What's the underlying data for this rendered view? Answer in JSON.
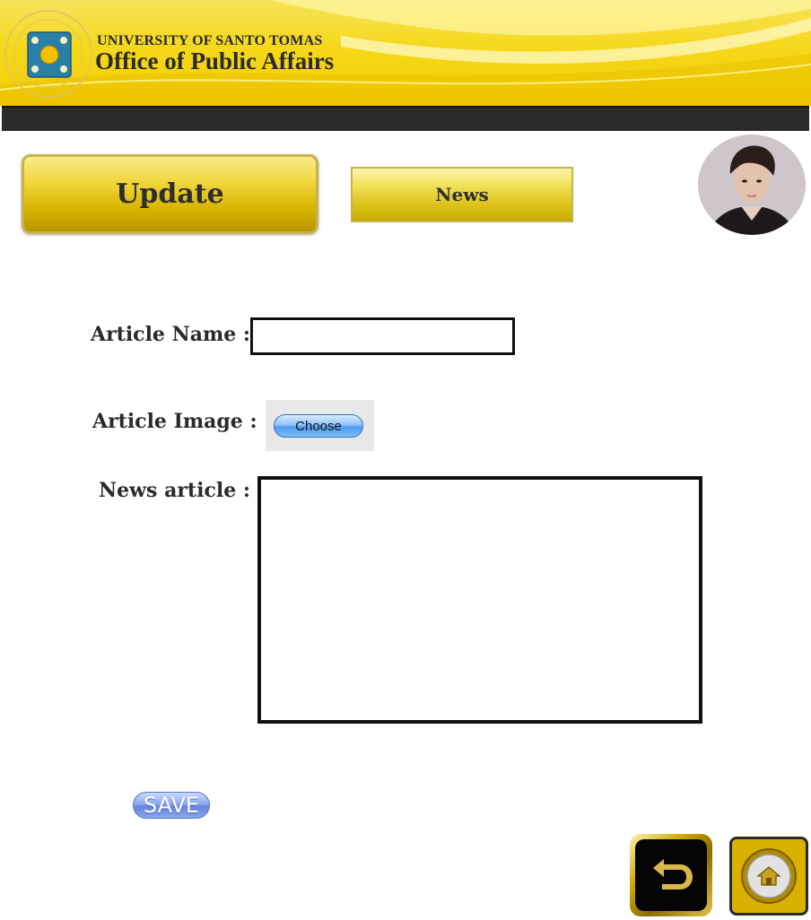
{
  "header": {
    "university": "UNIVERSITY OF SANTO TOMAS",
    "office": "Office of Public Affairs"
  },
  "nav": {
    "update_label": "Update",
    "news_label": "News"
  },
  "form": {
    "article_name_label": "Article Name :",
    "article_name_value": "",
    "article_image_label": "Article Image :",
    "choose_label": "Choose",
    "news_article_label": "News article :",
    "news_article_value": "",
    "save_label": "SAVE"
  },
  "icons": {
    "seal": "university-seal-icon",
    "avatar": "user-avatar",
    "back": "back-arrow-icon",
    "home": "home-icon"
  },
  "colors": {
    "banner_yellow": "#f5d81a",
    "dark_bar": "#2b2b2b",
    "gold": "#d8b400"
  }
}
